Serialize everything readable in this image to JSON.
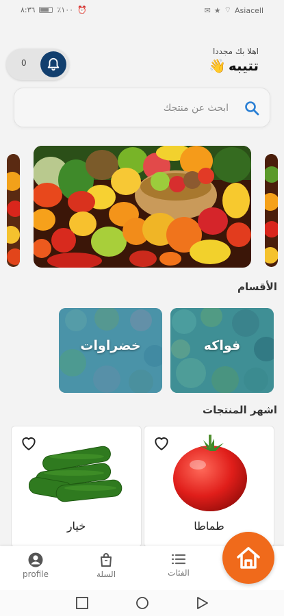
{
  "status_bar": {
    "time": "٨:٣٦",
    "battery_text": "٪١٠٠",
    "carrier": "Asiacell"
  },
  "header": {
    "greeting": "اهلا بك مجددا",
    "user_name": "تتيبه",
    "wave_emoji": "👋",
    "notification_count": "0"
  },
  "search": {
    "placeholder": "ابحث عن منتجك"
  },
  "sections": {
    "categories_title": "الأقسام",
    "popular_title": "اشهر المنتجات"
  },
  "categories": [
    {
      "label": "فواكه",
      "color": "#3f8f95"
    },
    {
      "label": "خضراوات",
      "color": "#4a93a8"
    }
  ],
  "products": [
    {
      "name": "طماطا"
    },
    {
      "name": "خيار"
    }
  ],
  "bottom_nav": {
    "categories_label": "الفئات",
    "cart_label": "السلة",
    "profile_label": "profile"
  },
  "colors": {
    "accent": "#f06a1b",
    "bell_bg": "#123f6e",
    "search_icon": "#2a7fd4"
  }
}
